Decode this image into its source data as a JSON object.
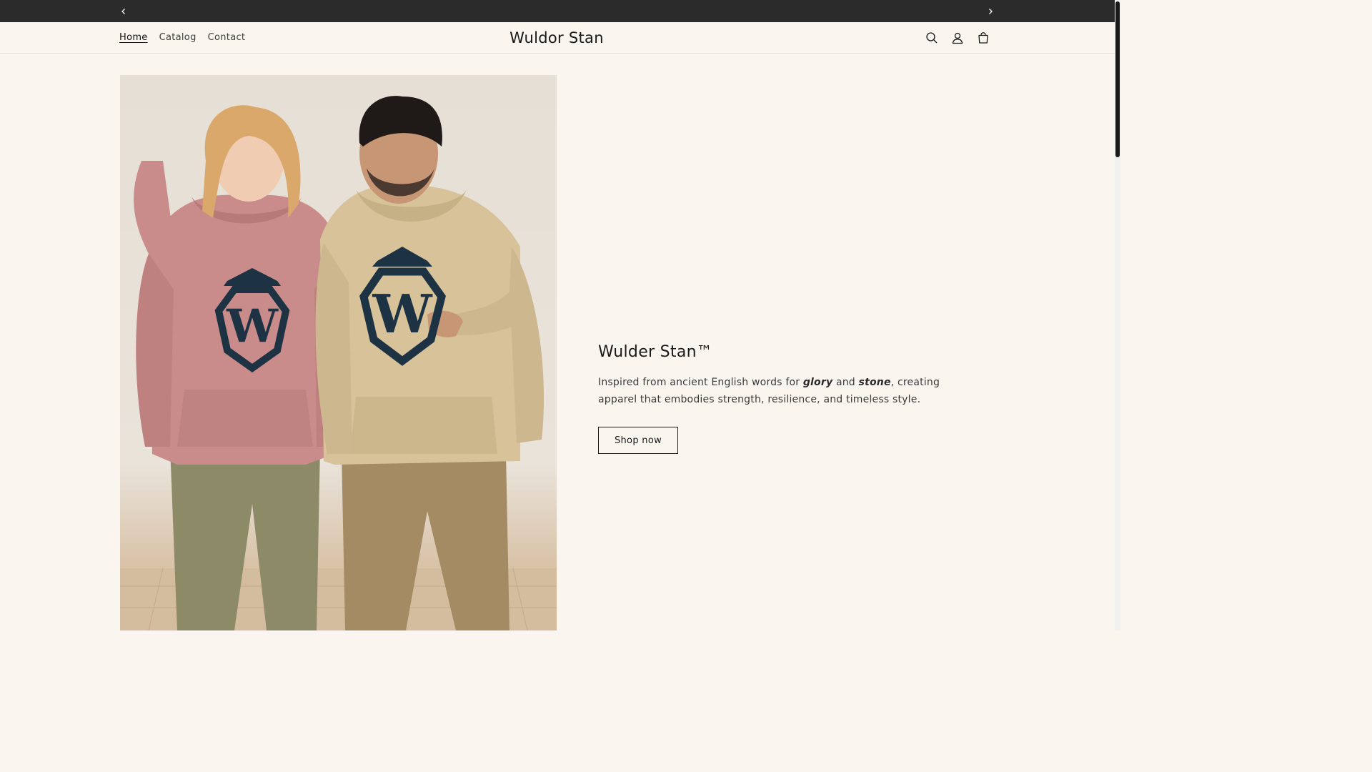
{
  "announcement": {
    "prev_icon": "chevron-left-icon",
    "next_icon": "chevron-right-icon"
  },
  "header": {
    "nav": [
      {
        "label": "Home",
        "active": true
      },
      {
        "label": "Catalog",
        "active": false
      },
      {
        "label": "Contact",
        "active": false
      }
    ],
    "brand": "Wuldor Stan",
    "icons": [
      "search-icon",
      "account-icon",
      "cart-icon"
    ]
  },
  "hero": {
    "image": "two people wearing pink and beige hoodies with crowned W shield logo",
    "title": "Wulder Stan™",
    "description": {
      "part1": "Inspired from ancient English words for ",
      "em1": "glory",
      "part2": " and ",
      "em2": "stone",
      "part3": ", creating apparel that embodies strength, resilience, and timeless style."
    },
    "button_label": "Shop now"
  },
  "colors": {
    "background": "#faf5ef",
    "announcement_bar": "#2b2b2b",
    "text": "#1a1a1a",
    "pink_hoodie": "#c98a8a",
    "beige_hoodie": "#d8c49c",
    "logo_navy": "#1d3344"
  }
}
